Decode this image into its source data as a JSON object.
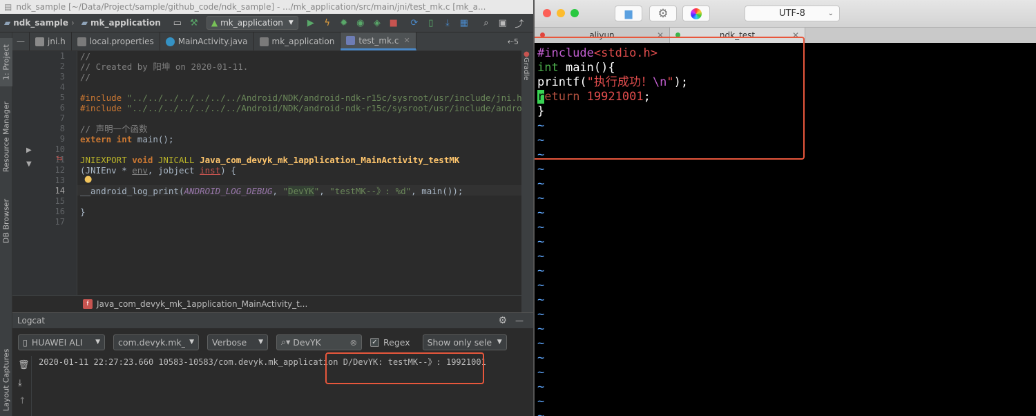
{
  "ide": {
    "window_title": "ndk_sample [~/Data/Project/sample/github_code/ndk_sample] - .../mk_application/src/main/jni/test_mk.c [mk_a...",
    "toolbar": {
      "project": "ndk_sample",
      "module": "mk_application",
      "run_config": "mk_application"
    },
    "left_tool_windows": [
      "1: Project",
      "Resource Manager",
      "DB Browser",
      "Layout Captures"
    ],
    "right_tool_windows": [
      "Gradle"
    ],
    "tabs": [
      {
        "label": "jni.h",
        "icon_color": "#8a8a8a"
      },
      {
        "label": "local.properties",
        "icon_color": "#7a7a7a"
      },
      {
        "label": "MainActivity.java",
        "icon_color": "#3592c4"
      },
      {
        "label": "mk_application",
        "icon_color": "#7a7a7a"
      },
      {
        "label": "test_mk.c",
        "icon_color": "#6e7db5",
        "active": true
      }
    ],
    "tabs_overflow": "⇠5",
    "line_numbers": [
      "1",
      "2",
      "3",
      "4",
      "5",
      "6",
      "7",
      "8",
      "9",
      "10",
      "11",
      "12",
      "13",
      "14",
      "15",
      "16",
      "17"
    ],
    "code": {
      "l1": "//",
      "l2": "// Created by 阳坤 on 2020-01-11.",
      "l3": "//",
      "l5_kw": "#include",
      "l5_str": " \"../../../../../../../Android/NDK/android-ndk-r15c/sysroot/usr/include/jni.h\"",
      "l6_kw": "#include",
      "l6_str": " \"../../../../../../../Android/NDK/android-ndk-r15c/sysroot/usr/include/android/",
      "l8": "// 声明一个函数",
      "l9_kw": "extern int",
      "l9_rest": " main();",
      "l11_mac": "JNIEXPORT",
      "l11_kw": " void",
      "l11_mac2": " JNICALL",
      "l11_fn": " Java_com_devyk_mk_1application_MainActivity_testMK",
      "l12_a": "(JNIEnv * ",
      "l12_b": "env",
      "l12_c": ", jobject ",
      "l12_d": "inst",
      "l12_e": ") {",
      "l14_a": "__android_log_print(",
      "l14_b": "ANDROID_LOG_DEBUG",
      "l14_c": ", ",
      "l14_d": "\"",
      "l14_e": "DevYK",
      "l14_f": "\"",
      "l14_g": ", ",
      "l14_h": "\"testMK--》: %d\"",
      "l14_i": ", main());",
      "l16": "}"
    },
    "breadcrumb": {
      "badge": "f",
      "label": "Java_com_devyk_mk_1application_MainActivity_t..."
    },
    "logcat": {
      "title": "Logcat",
      "device": "HUAWEI ALI",
      "package": "com.devyk.mk_",
      "level": "Verbose",
      "search_value": "DevYK",
      "regex_label": "Regex",
      "filter": "Show only sele",
      "log_line": "2020-01-11 22:27:23.660 10583-10583/com.devyk.mk_application D/DevYK: testMK--》: 19921001"
    }
  },
  "terminal": {
    "encoding": "UTF-8",
    "tabs": [
      {
        "label": "aliyun",
        "dot_color": "#e0443e"
      },
      {
        "label": "ndk_test",
        "dot_color": "#3cb44b"
      }
    ],
    "lines": {
      "l1_pp": "#include",
      "l1_str": "<stdio.h>",
      "l2_type": "int",
      "l2_rest": " main(){",
      "l3_a": "printf(",
      "l3_str": "\"执行成功！",
      "l3_esc": "\\n",
      "l3_q": "\"",
      "l3_end": ");",
      "l4_cur": "r",
      "l4_kw": "eturn",
      "l4_num": " 19921001",
      "l4_end": ";",
      "l5": "}"
    },
    "tilde": "~"
  },
  "colors": {
    "accent_box": "#e8573c"
  }
}
